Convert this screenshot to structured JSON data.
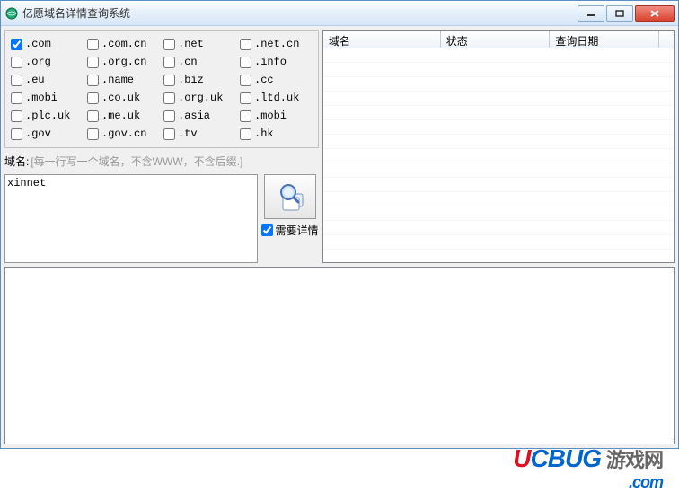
{
  "titlebar": {
    "title": "亿愿域名详情查询系统"
  },
  "extensions": [
    {
      "label": ".com",
      "checked": true
    },
    {
      "label": ".com.cn",
      "checked": false
    },
    {
      "label": ".net",
      "checked": false
    },
    {
      "label": ".net.cn",
      "checked": false
    },
    {
      "label": ".org",
      "checked": false
    },
    {
      "label": ".org.cn",
      "checked": false
    },
    {
      "label": ".cn",
      "checked": false
    },
    {
      "label": ".info",
      "checked": false
    },
    {
      "label": ".eu",
      "checked": false
    },
    {
      "label": ".name",
      "checked": false
    },
    {
      "label": ".biz",
      "checked": false
    },
    {
      "label": ".cc",
      "checked": false
    },
    {
      "label": ".mobi",
      "checked": false
    },
    {
      "label": ".co.uk",
      "checked": false
    },
    {
      "label": ".org.uk",
      "checked": false
    },
    {
      "label": ".ltd.uk",
      "checked": false
    },
    {
      "label": ".plc.uk",
      "checked": false
    },
    {
      "label": ".me.uk",
      "checked": false
    },
    {
      "label": ".asia",
      "checked": false
    },
    {
      "label": ".mobi",
      "checked": false
    },
    {
      "label": ".gov",
      "checked": false
    },
    {
      "label": ".gov.cn",
      "checked": false
    },
    {
      "label": ".tv",
      "checked": false
    },
    {
      "label": ".hk",
      "checked": false
    }
  ],
  "domain": {
    "label": "域名:",
    "hint": "[每一行写一个域名，不含WWW，不含后缀.]",
    "value": "xinnet"
  },
  "detail_checkbox": {
    "label": "需要详情",
    "checked": true
  },
  "table": {
    "columns": [
      "域名",
      "状态",
      "查询日期"
    ]
  },
  "watermark": {
    "brand1": "U",
    "brand2": "CBUG",
    "text": "游戏网",
    "suffix": ".com"
  }
}
